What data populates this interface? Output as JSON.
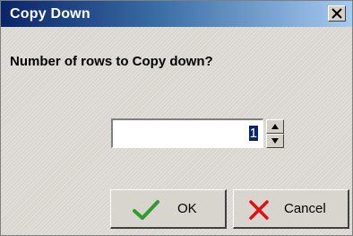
{
  "window": {
    "title": "Copy Down",
    "close_icon": "close-icon"
  },
  "prompt": "Number of rows to Copy down?",
  "rows_field": {
    "value": "1",
    "spin_up_icon": "spin-up-icon",
    "spin_down_icon": "spin-down-icon"
  },
  "buttons": {
    "ok": {
      "label": "OK",
      "icon": "checkmark-icon",
      "icon_color": "#2e9c2e"
    },
    "cancel": {
      "label": "Cancel",
      "icon": "x-icon",
      "icon_color": "#e01010"
    }
  },
  "colors": {
    "titlebar_start": "#0a246a",
    "titlebar_end": "#a6caf0",
    "dialog_bg": "#d8d5cf"
  }
}
